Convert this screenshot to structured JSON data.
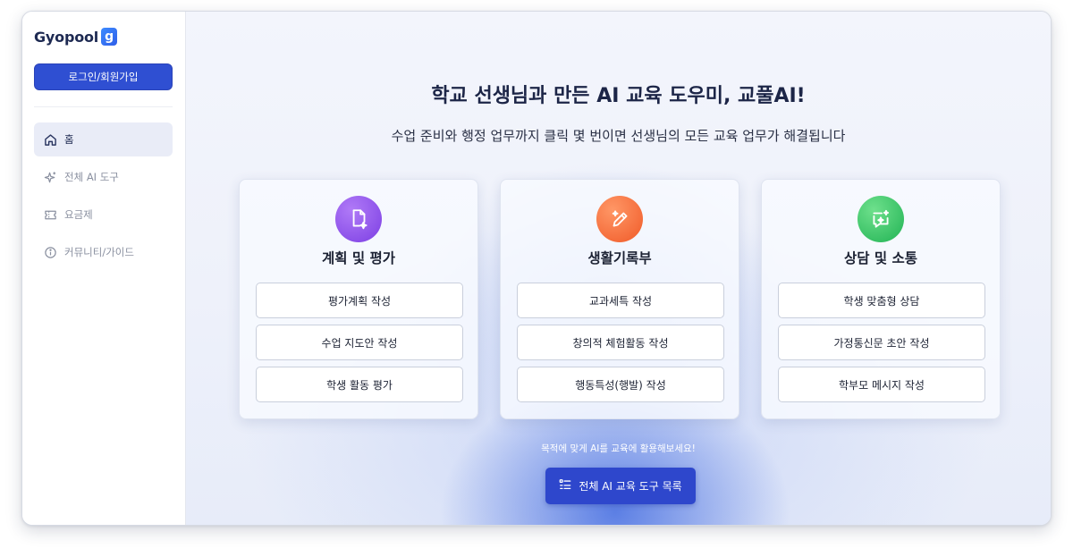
{
  "brand": {
    "name": "Gyopool",
    "mark": "g"
  },
  "sidebar": {
    "login_label": "로그인/회원가입",
    "items": [
      {
        "label": "홈",
        "icon": "home-icon",
        "active": true
      },
      {
        "label": "전체 AI 도구",
        "icon": "sparkle-icon",
        "active": false
      },
      {
        "label": "요금제",
        "icon": "ticket-icon",
        "active": false
      },
      {
        "label": "커뮤니티/가이드",
        "icon": "info-icon",
        "active": false
      }
    ]
  },
  "hero": {
    "title": "학교 선생님과 만든 AI 교육 도우미, 교풀AI!",
    "subtitle": "수업 준비와 행정 업무까지 클릭 몇 번이면 선생님의 모든 교육 업무가 해결됩니다"
  },
  "cards": [
    {
      "title": "계획 및 평가",
      "icon": "document-sparkle-icon",
      "color": "#7c3fe3",
      "buttons": [
        "평가계획 작성",
        "수업 지도안 작성",
        "학생 활동 평가"
      ]
    },
    {
      "title": "생활기록부",
      "icon": "pencil-sparkle-icon",
      "color": "#f05a28",
      "buttons": [
        "교과세특 작성",
        "창의적 체험활동 작성",
        "행동특성(행발) 작성"
      ]
    },
    {
      "title": "상담 및 소통",
      "icon": "chat-sparkle-icon",
      "color": "#21b354",
      "buttons": [
        "학생 맞춤형 상담",
        "가정통신문 초안 작성",
        "학부모 메시지 작성"
      ]
    }
  ],
  "footer": {
    "hint": "목적에 맞게 AI를 교육에 활용해보세요!",
    "all_tools_label": "전체 AI 교육 도구 목록",
    "all_tools_icon": "list-icon"
  },
  "colors": {
    "primary": "#2f4fd2",
    "sidebar_active_bg": "#e9ecf7"
  }
}
